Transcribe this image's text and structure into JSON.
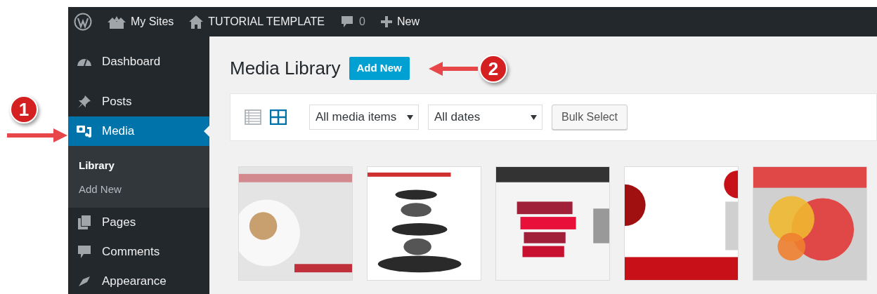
{
  "admin_bar": [
    {
      "kind": "logo"
    },
    {
      "kind": "sites",
      "label": "My Sites"
    },
    {
      "kind": "home",
      "label": "TUTORIAL TEMPLATE"
    },
    {
      "kind": "comments",
      "label": "0"
    },
    {
      "kind": "new",
      "label": "New"
    }
  ],
  "sidebar": {
    "items": [
      {
        "kind": "dashboard",
        "label": "Dashboard",
        "selected": false
      },
      {
        "kind": "posts",
        "label": "Posts",
        "selected": false
      },
      {
        "kind": "media",
        "label": "Media",
        "selected": true,
        "children": [
          {
            "label": "Library",
            "selected": true
          },
          {
            "label": "Add New",
            "selected": false
          }
        ]
      },
      {
        "kind": "pages",
        "label": "Pages",
        "selected": false
      },
      {
        "kind": "comments",
        "label": "Comments",
        "selected": false
      },
      {
        "kind": "appearance",
        "label": "Appearance",
        "selected": false
      }
    ]
  },
  "page": {
    "title": "Media Library",
    "add_button": "Add New"
  },
  "toolbar": {
    "views": [
      {
        "kind": "list",
        "selected": false
      },
      {
        "kind": "grid",
        "selected": true
      }
    ],
    "filters": [
      {
        "value": "All media items"
      },
      {
        "value": "All dates"
      }
    ],
    "bulk_button": "Bulk Select"
  },
  "annotations": [
    {
      "number": "1",
      "kind": "right"
    },
    {
      "number": "2",
      "kind": "left"
    }
  ]
}
